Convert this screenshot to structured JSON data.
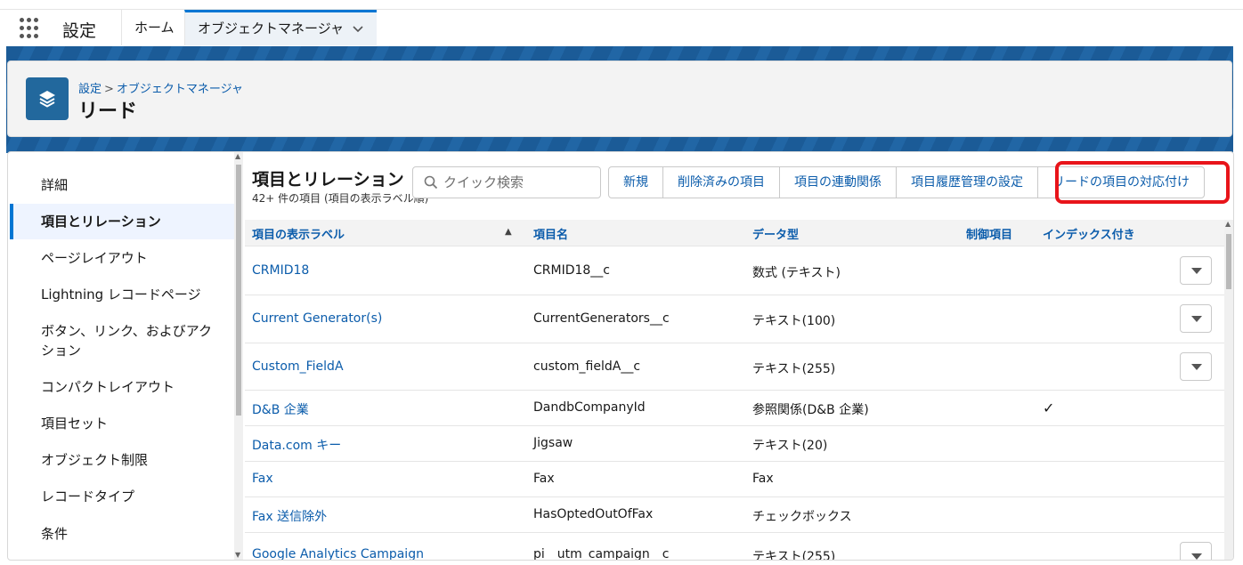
{
  "app": {
    "name": "設定"
  },
  "tabs": [
    {
      "label": "ホーム"
    },
    {
      "label": "オブジェクトマネージャ"
    }
  ],
  "header": {
    "breadcrumb_root": "設定",
    "breadcrumb_separator": ">",
    "breadcrumb_current": "オブジェクトマネージャ",
    "title": "リード"
  },
  "sidebar": {
    "items": [
      {
        "label": "詳細"
      },
      {
        "label": "項目とリレーション"
      },
      {
        "label": "ページレイアウト"
      },
      {
        "label": "Lightning レコードページ"
      },
      {
        "label": "ボタン、リンク、およびアクション"
      },
      {
        "label": "コンパクトレイアウト"
      },
      {
        "label": "項目セット"
      },
      {
        "label": "オブジェクト制限"
      },
      {
        "label": "レコードタイプ"
      },
      {
        "label": "条件"
      }
    ],
    "active_index": 1
  },
  "section": {
    "title": "項目とリレーション",
    "subtitle": "42+ 件の項目 (項目の表示ラベル順)",
    "search_placeholder": "クイック検索"
  },
  "buttons": {
    "new": "新規",
    "deleted_fields": "削除済みの項目",
    "field_dependencies": "項目の連動関係",
    "history_tracking": "項目履歴管理の設定",
    "map_lead_fields": "リードの項目の対応付け"
  },
  "table": {
    "columns": [
      "項目の表示ラベル",
      "項目名",
      "データ型",
      "制御項目",
      "インデックス付き"
    ],
    "rows": [
      {
        "label": "CRMID18",
        "name": "CRMID18__c",
        "type": "数式 (テキスト)",
        "controlling": "",
        "indexed": false,
        "menu": true
      },
      {
        "label": "Current Generator(s)",
        "name": "CurrentGenerators__c",
        "type": "テキスト(100)",
        "controlling": "",
        "indexed": false,
        "menu": true
      },
      {
        "label": "Custom_FieldA",
        "name": "custom_fieldA__c",
        "type": "テキスト(255)",
        "controlling": "",
        "indexed": false,
        "menu": true
      },
      {
        "label": "D&B 企業",
        "name": "DandbCompanyId",
        "type": "参照関係(D&B 企業)",
        "controlling": "",
        "indexed": true,
        "menu": false
      },
      {
        "label": "Data.com キー",
        "name": "Jigsaw",
        "type": "テキスト(20)",
        "controlling": "",
        "indexed": false,
        "menu": false
      },
      {
        "label": "Fax",
        "name": "Fax",
        "type": "Fax",
        "controlling": "",
        "indexed": false,
        "menu": false
      },
      {
        "label": "Fax 送信除外",
        "name": "HasOptedOutOfFax",
        "type": "チェックボックス",
        "controlling": "",
        "indexed": false,
        "menu": false
      },
      {
        "label": "Google Analytics Campaign",
        "name": "pi__utm_campaign__c",
        "type": "テキスト(255)",
        "controlling": "",
        "indexed": false,
        "menu": true
      }
    ],
    "checkmark": "✓"
  },
  "colors": {
    "accent": "#0176d3",
    "link": "#0b5cab",
    "highlight": "#e8141a",
    "band": "#1b5b97"
  },
  "icons": [
    "app-launcher-icon",
    "chevron-down-icon",
    "stack-icon",
    "search-icon",
    "sort-ascending-icon",
    "row-menu-icon"
  ]
}
